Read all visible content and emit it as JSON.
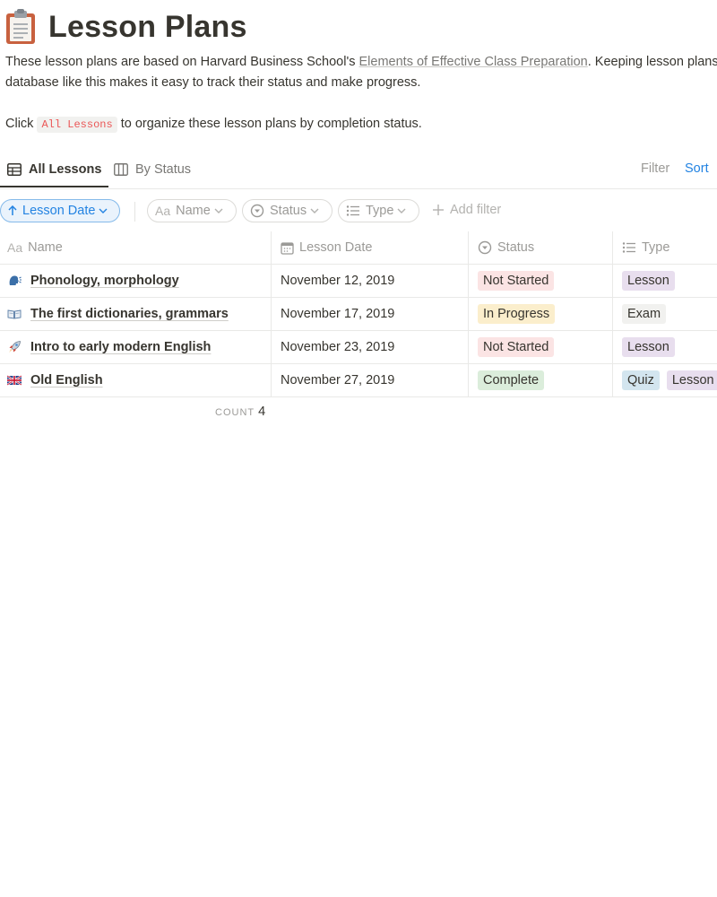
{
  "page": {
    "title": "Lesson Plans",
    "title_icon": "clipboard-icon",
    "description_part1": "These lesson plans are based on Harvard Business School's ",
    "description_link": "Elements of Effective Class Preparation",
    "description_part2": ". Keeping lesson plans in a",
    "description_line2": "database like this makes it easy to track their status and make progress.",
    "click_prefix": "Click ",
    "click_code": "All Lessons",
    "click_suffix": " to organize these lesson plans by completion status."
  },
  "tabs": [
    {
      "label": "All Lessons",
      "icon": "table-icon",
      "active": true
    },
    {
      "label": "By Status",
      "icon": "board-icon",
      "active": false
    }
  ],
  "view_actions": {
    "filter": "Filter",
    "sort": "Sort"
  },
  "filter_bar": {
    "sort_pill": "Lesson Date",
    "name_pill": "Name",
    "status_pill": "Status",
    "type_pill": "Type",
    "add_filter": "Add filter"
  },
  "columns": {
    "name": "Name",
    "date": "Lesson Date",
    "status": "Status",
    "type": "Type"
  },
  "rows": [
    {
      "emoji": "speaking-head-icon",
      "name": "Phonology, morphology",
      "date": "November 12, 2019",
      "status": "Not Started",
      "types": [
        "Lesson"
      ]
    },
    {
      "emoji": "open-book-icon",
      "name": "The first dictionaries, grammars",
      "date": "November 17, 2019",
      "status": "In Progress",
      "types": [
        "Exam"
      ]
    },
    {
      "emoji": "rocket-icon",
      "name": "Intro to early modern English",
      "date": "November 23, 2019",
      "status": "Not Started",
      "types": [
        "Lesson"
      ]
    },
    {
      "emoji": "uk-flag-icon",
      "name": "Old English",
      "date": "November 27, 2019",
      "status": "Complete",
      "types": [
        "Quiz",
        "Lesson"
      ]
    }
  ],
  "footer": {
    "count_label": "COUNT",
    "count_value": "4"
  },
  "colors": {
    "accent": "#2383e2",
    "not_started": "#fbe4e4",
    "in_progress": "#fbeecc",
    "complete": "#dbeddb",
    "lesson": "#e8deee",
    "exam": "#f1f1ef",
    "quiz": "#d3e5ef"
  }
}
